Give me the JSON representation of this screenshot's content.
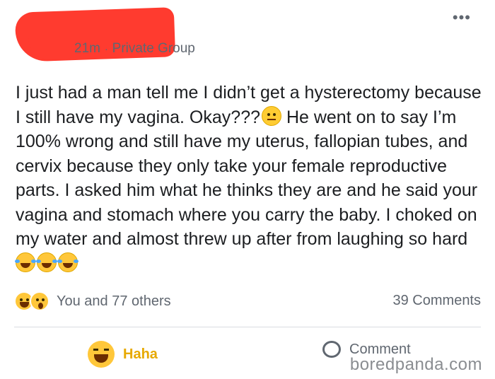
{
  "post": {
    "time": "21m",
    "separator": "·",
    "audience": "Private Group",
    "more_label": "•••",
    "text_part1": "I just had a man tell me I didn’t get a hysterectomy because I still have my vagina. Okay???",
    "text_part2": " He went on to say I’m 100% wrong and still have my uterus, fallopian tubes, and cervix because they only take your female reproductive parts. I asked him what he thinks they are and he said your vagina and stomach where you carry the baby. I choked on my water and almost threw up after from laughing so hard"
  },
  "reactions": {
    "icons": [
      "haha-icon",
      "wow-icon"
    ],
    "summary": "You and 77 others",
    "comments": "39 Comments"
  },
  "actions": {
    "haha_label": "Haha",
    "comment_label": "Comment"
  },
  "watermark": "boredpanda.com",
  "colors": {
    "redaction": "#ff3b2f",
    "haha": "#e7a900",
    "meta": "#606770"
  }
}
